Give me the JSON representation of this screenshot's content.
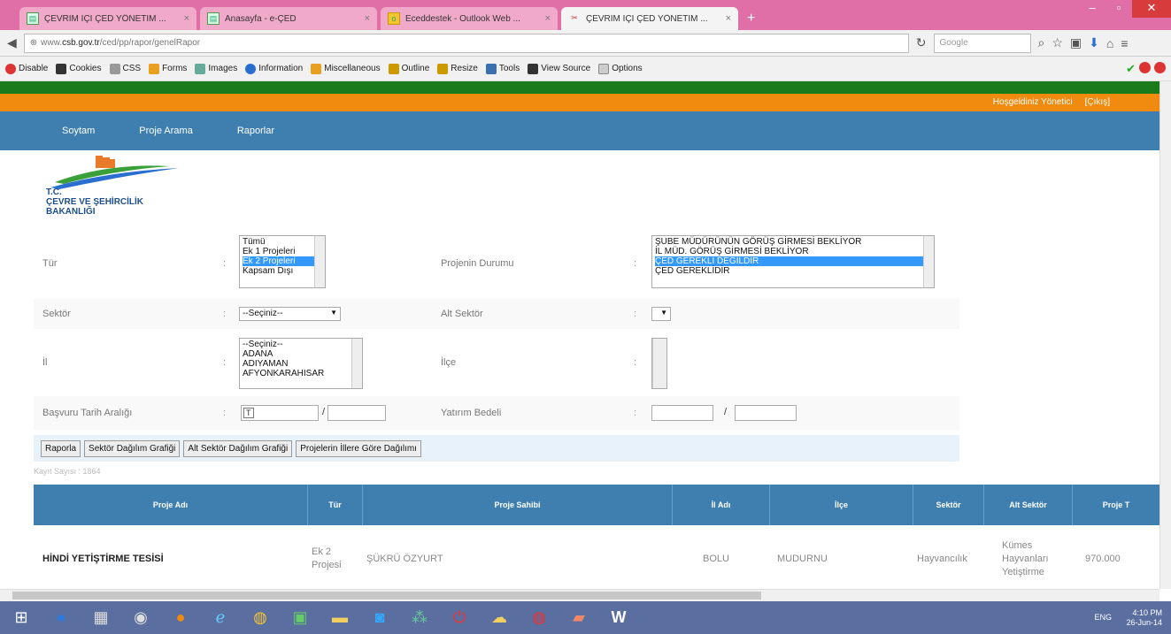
{
  "browser": {
    "tabs": [
      {
        "title": "ÇEVRİM İÇİ ÇED YÖNETİM ...",
        "active": false
      },
      {
        "title": "Anasayfa - e-ÇED",
        "active": false
      },
      {
        "title": "Eceddestek - Outlook Web ...",
        "active": false
      },
      {
        "title": "ÇEVRİM İÇİ ÇED YÖNETİM ...",
        "active": true
      }
    ],
    "url_prefix": "www.",
    "url_domain": "csb.gov.tr",
    "url_path": "/ced/pp/rapor/genelRapor",
    "search_placeholder": "Google",
    "bookmarks": [
      "Disable",
      "Cookies",
      "CSS",
      "Forms",
      "Images",
      "Information",
      "Miscellaneous",
      "Outline",
      "Resize",
      "Tools",
      "View Source",
      "Options"
    ]
  },
  "header": {
    "welcome": "Hoşgeldiniz Yönetici",
    "logout": "[Çıkış]"
  },
  "nav": [
    "Soytam",
    "Proje Arama",
    "Raporlar"
  ],
  "logo": {
    "line1": "T.C.",
    "line2": "ÇEVRE VE ŞEHİRCİLİK",
    "line3": "BAKANLIĞI"
  },
  "form": {
    "tur": {
      "label": "Tür",
      "options": [
        "Tümü",
        "Ek 1 Projeleri",
        "Ek 2 Projeleri",
        "Kapsam Dışı"
      ],
      "selected": 2
    },
    "durum": {
      "label": "Projenin Durumu",
      "options": [
        "ŞUBE MÜDÜRÜNÜN GÖRÜŞ GİRMESİ BEKLİYOR",
        "İL MÜD. GÖRÜŞ GİRMESİ BEKLİYOR",
        "ÇED GEREKLİ DEĞİLDİR",
        "ÇED GEREKLİDİR"
      ],
      "selected": 2
    },
    "sektor": {
      "label": "Sektör",
      "value": "--Seçiniz--"
    },
    "alt_sektor": {
      "label": "Alt Sektör"
    },
    "il": {
      "label": "İl",
      "options": [
        "--Seçiniz--",
        "ADANA",
        "ADIYAMAN",
        "AFYONKARAHISAR"
      ]
    },
    "ilce": {
      "label": "İlçe"
    },
    "tarih": {
      "label": "Başvuru Tarih Aralığı",
      "icon": "T"
    },
    "bedel": {
      "label": "Yatırım Bedeli"
    }
  },
  "buttons": [
    "Raporla",
    "Sektör Dağılım Grafiği",
    "Alt Sektör Dağılım Grafiği",
    "Projelerin İllere Göre Dağılımı"
  ],
  "record_count": "Kayıt Sayısı : 1864",
  "table": {
    "headers": [
      "Proje Adı",
      "Tür",
      "Proje Sahibi",
      "İl Adı",
      "İlçe",
      "Sektör",
      "Alt Sektör",
      "Proje T"
    ],
    "rows": [
      [
        "HİNDİ YETİŞTİRME TESİSİ",
        "Ek 2 Projesi",
        "ŞÜKRÜ ÖZYURT",
        "BOLU",
        "MUDURNU",
        "Hayvancılık",
        "Kümes Hayvanları Yetiştirme",
        "970.000"
      ]
    ]
  },
  "taskbar": {
    "time": "4:10 PM",
    "date": "26-Jun-14",
    "lang": "ENG"
  }
}
